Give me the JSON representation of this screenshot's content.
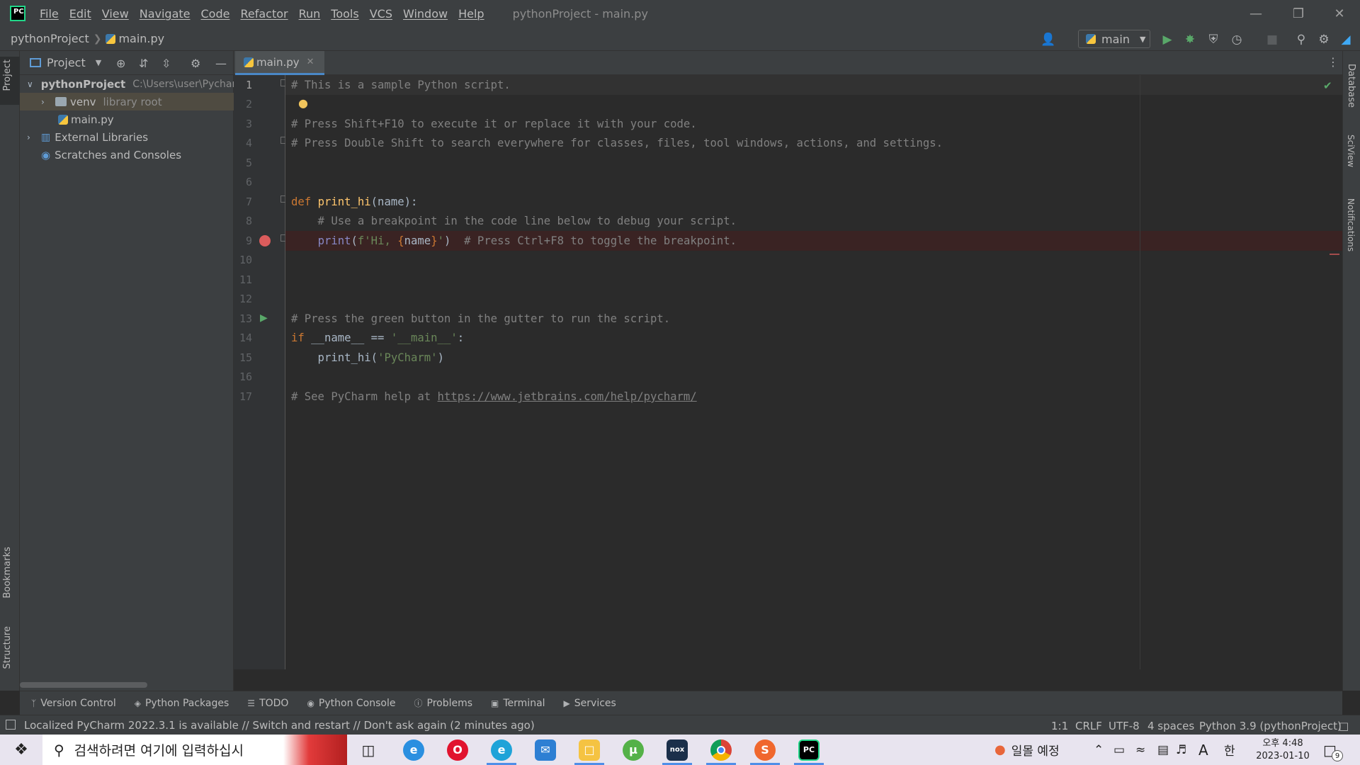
{
  "app": {
    "window_title": "pythonProject - main.py",
    "logo_text": "PC"
  },
  "menu": [
    "File",
    "Edit",
    "View",
    "Navigate",
    "Code",
    "Refactor",
    "Run",
    "Tools",
    "VCS",
    "Window",
    "Help"
  ],
  "breadcrumb": {
    "project": "pythonProject",
    "file": "main.py"
  },
  "toolbar": {
    "run_config": "main"
  },
  "left_stripe": {
    "project": "Project",
    "bookmarks": "Bookmarks",
    "structure": "Structure"
  },
  "right_stripe": {
    "database": "Database",
    "sciview": "SciView",
    "notifications": "Notifications"
  },
  "project_panel": {
    "title": "Project",
    "tree": {
      "root_name": "pythonProject",
      "root_path": "C:\\Users\\user\\PycharmProjects\\pythonProject",
      "venv": "venv",
      "venv_note": "library root",
      "main": "main.py",
      "external": "External Libraries",
      "scratches": "Scratches and Consoles"
    }
  },
  "editor": {
    "tab_label": "main.py",
    "line_numbers": [
      "1",
      "2",
      "3",
      "4",
      "5",
      "6",
      "7",
      "8",
      "9",
      "10",
      "11",
      "12",
      "13",
      "14",
      "15",
      "16",
      "17"
    ],
    "code": {
      "l1": "# This is a sample Python script.",
      "l3": "# Press Shift+F10 to execute it or replace it with your code.",
      "l4": "# Press Double Shift to search everywhere for classes, files, tool windows, actions, and settings.",
      "l7_kw": "def ",
      "l7_fn": "print_hi",
      "l7_rest": "(name):",
      "l8": "    # Use a breakpoint in the code line below to debug your script.",
      "l9_indent": "    ",
      "l9_print": "print",
      "l9_open": "(",
      "l9_str1": "f'Hi, ",
      "l9_brace_open": "{",
      "l9_name": "name",
      "l9_brace_close": "}",
      "l9_str2": "'",
      "l9_close": ")",
      "l9_comment": "  # Press Ctrl+F8 to toggle the breakpoint.",
      "l12": "# Press the green button in the gutter to run the script.",
      "l13_kw": "if ",
      "l13_mid": "__name__ == ",
      "l13_str": "'__main__'",
      "l13_end": ":",
      "l14_call": "    print_hi(",
      "l14_str": "'PyCharm'",
      "l14_end": ")",
      "l16_prefix": "# See PyCharm help at ",
      "l16_link": "https://www.jetbrains.com/help/pycharm/"
    }
  },
  "bottom_tabs": [
    "Version Control",
    "Python Packages",
    "TODO",
    "Python Console",
    "Problems",
    "Terminal",
    "Services"
  ],
  "status": {
    "message": "Localized PyCharm 2022.3.1 is available // Switch and restart // Don't ask again (2 minutes ago)",
    "position": "1:1",
    "line_sep": "CRLF",
    "encoding": "UTF-8",
    "indent": "4 spaces",
    "interpreter": "Python 3.9 (pythonProject)"
  },
  "taskbar": {
    "search_placeholder": "검색하려면 여기에 입력하십시",
    "weather": "일몰 예정",
    "ime_a": "A",
    "ime_han": "한",
    "time": "오후 4:48",
    "date": "2023-01-10",
    "notif_count": "9",
    "apps": {
      "nox": "nox",
      "s": "S",
      "pc": "PC"
    }
  }
}
